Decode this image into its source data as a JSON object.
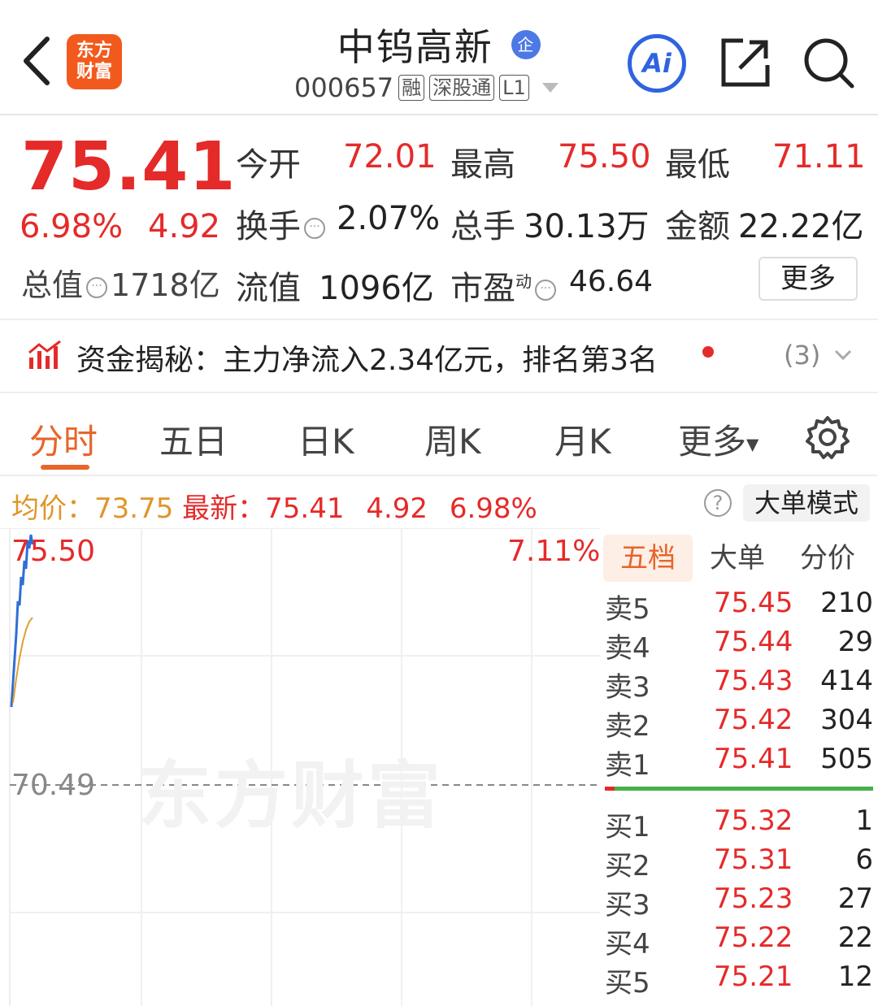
{
  "header": {
    "logo_text": "东方\n财富",
    "stock_name": "中钨高新",
    "ent_badge": "企",
    "code": "000657",
    "tags": [
      "融",
      "深股通",
      "L1"
    ],
    "ai_label": "Ai"
  },
  "quote": {
    "price": "75.41",
    "change_pct": "6.98%",
    "change_amt": "4.92",
    "total_cap_label": "总值",
    "total_cap_value": "1718亿",
    "open_label": "今开",
    "open_value": "72.01",
    "high_label": "最高",
    "high_value": "75.50",
    "low_label": "最低",
    "low_value": "71.11",
    "turnover_label": "换手",
    "turnover_value": "2.07%",
    "volume_label": "总手",
    "volume_value": "30.13万",
    "amount_label": "金额",
    "amount_value": "22.22亿",
    "float_cap_label": "流值",
    "float_cap_value": "1096亿",
    "pe_label": "市盈",
    "pe_sup": "动",
    "pe_value": "46.64",
    "more_label": "更多"
  },
  "fund_banner": {
    "text": "资金揭秘：主力净流入2.34亿元，排名第3名",
    "count": "(3)"
  },
  "tabs": [
    "分时",
    "五日",
    "日K",
    "周K",
    "月K",
    "更多"
  ],
  "avg_row": {
    "avg_label": "均价：",
    "avg_value": "73.75",
    "latest_label": "最新：",
    "latest_value": "75.41",
    "latest_change": "4.92",
    "latest_pct": "6.98%",
    "help": "?",
    "mode_label": "大单模式"
  },
  "chart": {
    "y_max": "75.50",
    "pct_max": "7.11%",
    "y_base": "70.49",
    "watermark": "东方财富"
  },
  "order_book": {
    "tabs": [
      "五档",
      "大单",
      "分价"
    ],
    "asks": [
      {
        "label": "卖5",
        "price": "75.45",
        "vol": "210"
      },
      {
        "label": "卖4",
        "price": "75.44",
        "vol": "29"
      },
      {
        "label": "卖3",
        "price": "75.43",
        "vol": "414"
      },
      {
        "label": "卖2",
        "price": "75.42",
        "vol": "304"
      },
      {
        "label": "卖1",
        "price": "75.41",
        "vol": "505"
      }
    ],
    "bids": [
      {
        "label": "买1",
        "price": "75.32",
        "vol": "1"
      },
      {
        "label": "买2",
        "price": "75.31",
        "vol": "6"
      },
      {
        "label": "买3",
        "price": "75.23",
        "vol": "27"
      },
      {
        "label": "买4",
        "price": "75.22",
        "vol": "22"
      },
      {
        "label": "买5",
        "price": "75.21",
        "vol": "12"
      }
    ]
  },
  "colors": {
    "up_red": "#e52a2a",
    "accent_orange": "#e8642a",
    "price_line": "#2f6fd6",
    "avg_line": "#e0a030",
    "bid_green": "#46b04a"
  }
}
